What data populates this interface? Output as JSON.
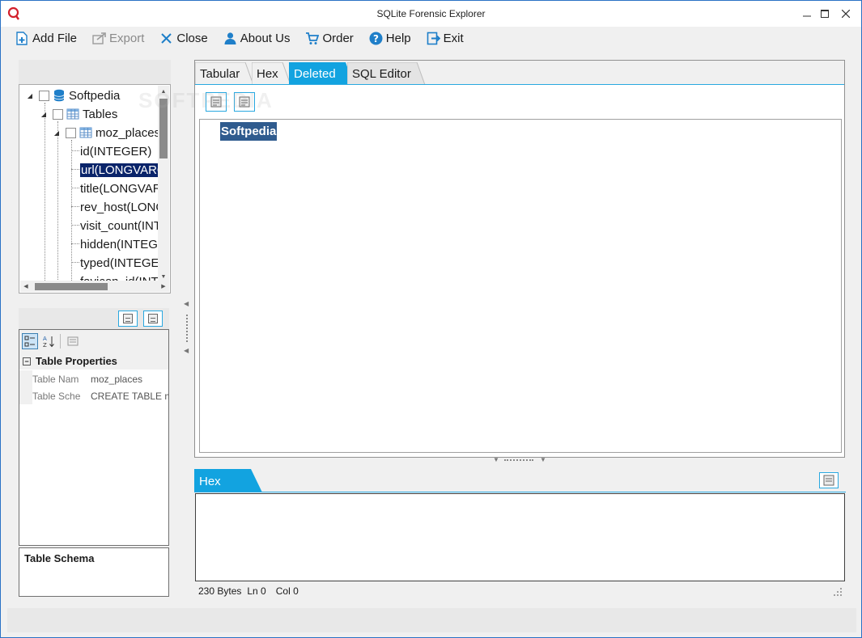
{
  "window": {
    "title": "SQLite Forensic Explorer",
    "accent": "#29a8e0"
  },
  "toolbar": {
    "add_file": "Add File",
    "export": "Export",
    "close": "Close",
    "about_us": "About Us",
    "order": "Order",
    "help": "Help",
    "exit": "Exit"
  },
  "tree": {
    "root": "Softpedia",
    "tables_node": "Tables",
    "table": "moz_places",
    "columns": [
      "id(INTEGER)",
      "url(LONGVARC",
      "title(LONGVAR",
      "rev_host(LONG",
      "visit_count(INT",
      "hidden(INTEG",
      "typed(INTEGEI",
      "favicon_id(INT"
    ],
    "selected_index": 1
  },
  "properties": {
    "category": "Table Properties",
    "rows": [
      {
        "name": "Table Nam",
        "value": "moz_places"
      },
      {
        "name": "Table Sche",
        "value": "CREATE TABLE m"
      }
    ],
    "schema_label": "Table Schema"
  },
  "main_tabs": {
    "tabular": "Tabular",
    "hex": "Hex",
    "deleted": "Deleted",
    "sql_editor": "SQL Editor",
    "active": "Deleted"
  },
  "content": {
    "db_label": "Softpedia"
  },
  "hex_panel": {
    "tab": "Hex",
    "bytes": "230 Bytes",
    "line": "Ln 0",
    "col": "Col 0"
  },
  "watermark": "SOFTPEDIA"
}
